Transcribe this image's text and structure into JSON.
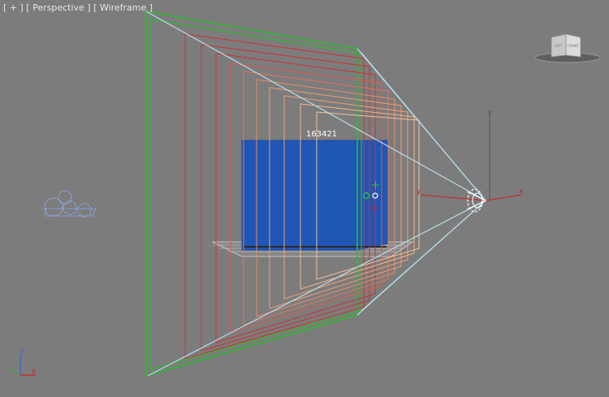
{
  "viewport": {
    "menu_plus": "[ + ]",
    "view_name": "[ Perspective ]",
    "shading_mode": "[ Wireframe ]"
  },
  "scene": {
    "object_label": "163421"
  },
  "viewcube": {
    "left_face": "LEFT",
    "front_face": "FRONT"
  },
  "axis_labels": {
    "x": "x",
    "y": "y",
    "z": "z"
  },
  "colors": {
    "background": "#7c7c7c",
    "cube_fill": "#2056b5",
    "frustum_green": "#2dbb2d",
    "frustum_red": "#d03030",
    "frustum_orange": "#f0a070",
    "light_ray": "#b8dcea",
    "gizmo_x": "#d02020",
    "gizmo_z": "#5a5a5a"
  }
}
